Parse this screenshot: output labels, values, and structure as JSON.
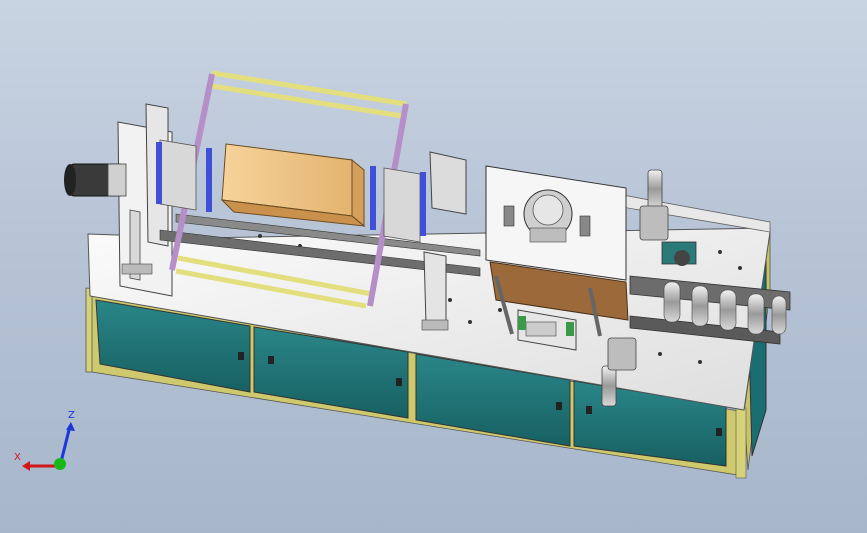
{
  "viewport": {
    "background_top": "#c9d4e2",
    "background_bottom": "#a7b6cb"
  },
  "colors": {
    "cabinet_panel": "#1f7577",
    "frame_yellow": "#d6d27a",
    "machine_table": "#f0f0f0",
    "product_box": "#f0c98a",
    "guide_purple": "#b18bc9",
    "slot_blue": "#3f4fd8"
  },
  "triad": {
    "x_label": "X",
    "z_label": "Z",
    "x_color": "#d01818",
    "y_color": "#18b818",
    "z_color": "#1c36d8"
  }
}
